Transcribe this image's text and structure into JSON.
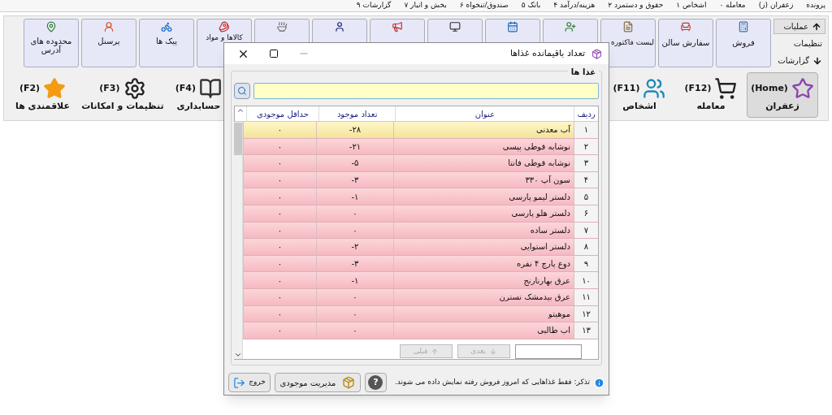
{
  "menu_bar": [
    "پرونده",
    "زعفران (ز)",
    "معامله ۰",
    "اشخاص ۱",
    "حقوق و دستمزد ۲",
    "هزینه/درآمد ۴",
    "بانک ۵",
    "صندوق/تنخواه ۶",
    "بخش و انبار ۷",
    "گزارشات ۹"
  ],
  "side_nav": [
    {
      "label": "عملیات",
      "selected": true
    },
    {
      "label": "تنظیمات",
      "selected": false
    },
    {
      "label": "گزارشات",
      "selected": false
    }
  ],
  "ribbon_buttons_right": [
    "فروش",
    "سفارش سالن",
    "لیست فاکتوره"
  ],
  "ribbon_buttons_left": [
    "کالاها و مواد",
    "پیک ها",
    "پرسنل",
    "محدوده های آدرس"
  ],
  "modules": [
    {
      "hotkey": "(Home)",
      "label": "زعفران",
      "selected": true
    },
    {
      "hotkey": "(F12)",
      "label": "معامله",
      "selected": false
    },
    {
      "hotkey": "(F11)",
      "label": "اشخاص",
      "selected": false
    },
    {
      "hotkey": "(F4)",
      "label": "حسابداری",
      "selected": false
    },
    {
      "hotkey": "(F3)",
      "label": "تنظیمات و امکانات",
      "selected": false
    },
    {
      "hotkey": "(F2)",
      "label": "علاقمندی ها",
      "selected": false
    }
  ],
  "dialog": {
    "title": "تعداد باقیمانده غذاها",
    "group": "غذا ها",
    "table": {
      "columns": [
        "ردیف",
        "عنوان",
        "تعداد موجود",
        "حداقل موجودی"
      ],
      "rows": [
        {
          "cells": [
            "۱",
            "آب معدنی",
            "-۲۸",
            "۰"
          ],
          "selected": true
        },
        {
          "cells": [
            "۲",
            "نوشابه قوطی پپسی",
            "-۲۱",
            "۰"
          ],
          "selected": false
        },
        {
          "cells": [
            "۳",
            "نوشابه قوطی فانتا",
            "-۵",
            "۰"
          ],
          "selected": false
        },
        {
          "cells": [
            "۴",
            "سون آپ ۳۳۰",
            "-۳",
            "۰"
          ],
          "selected": false
        },
        {
          "cells": [
            "۵",
            "دلستر لیمو پارسی",
            "-۱",
            "۰"
          ],
          "selected": false
        },
        {
          "cells": [
            "۶",
            "دلستر هلو پارسی",
            "۰",
            "۰"
          ],
          "selected": false
        },
        {
          "cells": [
            "۷",
            "دلستر ساده",
            "۰",
            "۰"
          ],
          "selected": false
        },
        {
          "cells": [
            "۸",
            "دلستر استوایی",
            "-۲",
            "۰"
          ],
          "selected": false
        },
        {
          "cells": [
            "۹",
            "دوغ پارچ ۴ نفره",
            "-۳",
            "۰"
          ],
          "selected": false
        },
        {
          "cells": [
            "۱۰",
            "عرق بهارنارنج",
            "-۱",
            "۰"
          ],
          "selected": false
        },
        {
          "cells": [
            "۱۱",
            "عرق بیدمشک نسترن",
            "۰",
            "۰"
          ],
          "selected": false
        },
        {
          "cells": [
            "۱۲",
            "موهیتو",
            "۰",
            "۰"
          ],
          "selected": false
        },
        {
          "cells": [
            "۱۳",
            "اب طالبی",
            "۰",
            "۰"
          ],
          "selected": false
        }
      ]
    },
    "next_button": {
      "label": "بعدی",
      "disabled": true
    },
    "prev_button": {
      "label": "قبلی",
      "disabled": true
    },
    "note": "تذکر: فقط غذاهایی که امروز فروش رفته نمایش داده می شوند.",
    "help_button": "?",
    "manage_button": "مدیریت موجودی",
    "exit_button": "خروج"
  }
}
